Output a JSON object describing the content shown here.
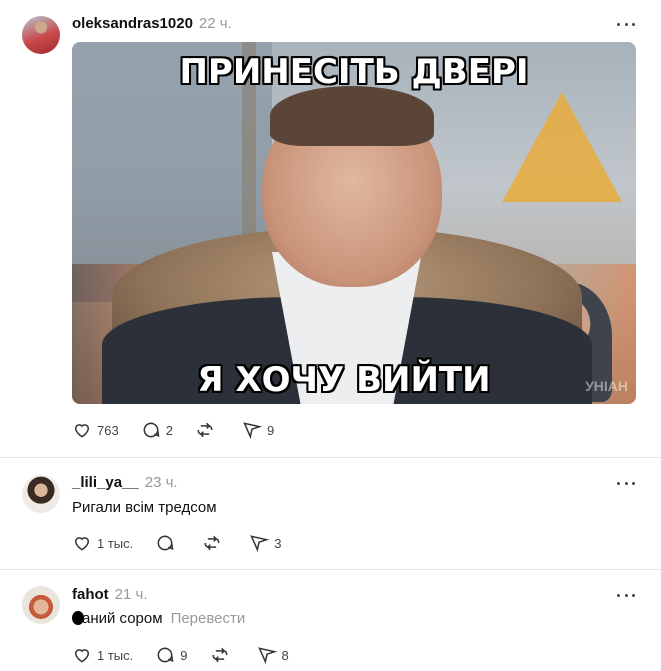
{
  "posts": [
    {
      "author": "oleksandras1020",
      "time": "22 ч.",
      "meme": {
        "top_caption": "ПРИНЕСІТЬ ДВЕРІ",
        "bottom_caption": "Я ХОЧУ ВИЙТИ",
        "watermark": "УНІАН"
      },
      "likes": "763",
      "replies": "2",
      "reposts": "",
      "shares": "9"
    },
    {
      "author": "_lili_ya__",
      "time": "23 ч.",
      "text": "Ригали всім тредсом",
      "likes": "1 тыс.",
      "replies": "",
      "reposts": "",
      "shares": "3"
    },
    {
      "author": "fahot",
      "time": "21 ч.",
      "text": "аний сором",
      "translate": "Перевести",
      "likes": "1 тыс.",
      "replies": "9",
      "reposts": "",
      "shares": "8"
    }
  ]
}
